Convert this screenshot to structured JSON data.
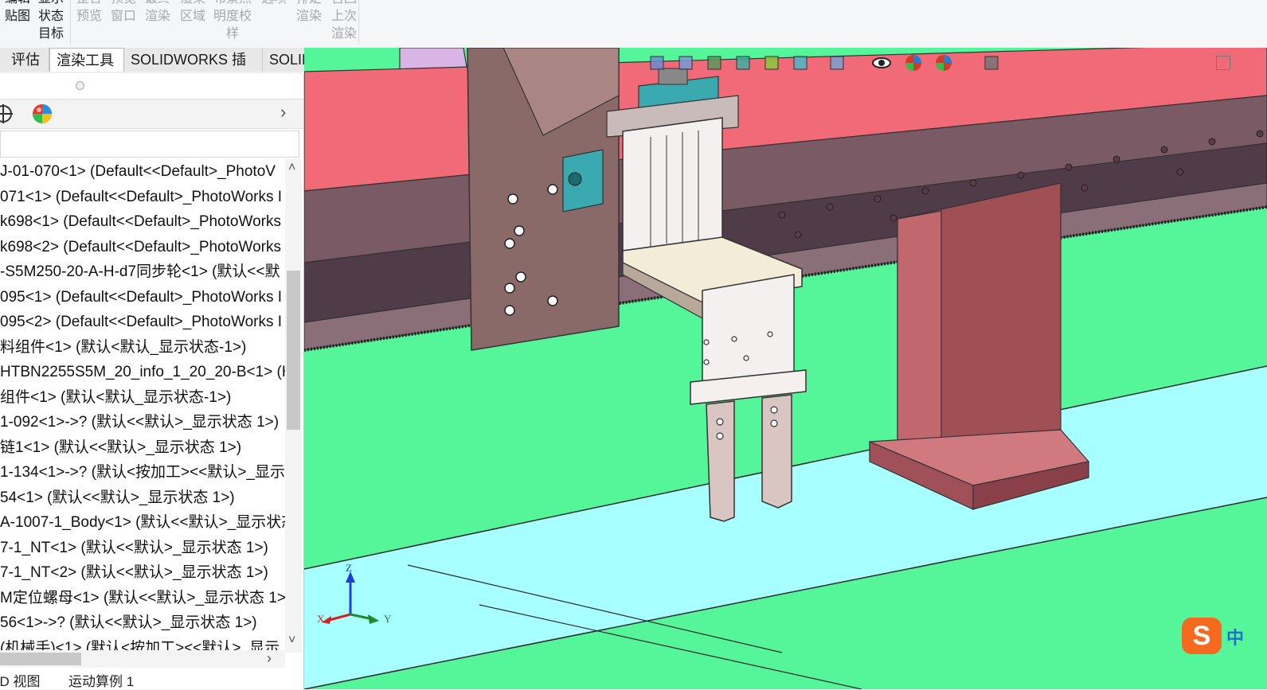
{
  "ribbon": {
    "groups": [
      {
        "lines": [
          "编辑",
          "贴图"
        ],
        "active": true
      },
      {
        "lines": [
          "显示",
          "状态",
          "目标"
        ],
        "active": true
      },
      {
        "lines": [
          "整合",
          "预览"
        ],
        "active": false
      },
      {
        "lines": [
          "预览",
          "窗口"
        ],
        "active": false
      },
      {
        "lines": [
          "最终",
          "渲染"
        ],
        "active": false
      },
      {
        "lines": [
          "渲染",
          "区域"
        ],
        "active": false
      },
      {
        "lines": [
          "布景照",
          "明度校",
          "样"
        ],
        "active": false
      },
      {
        "lines": [
          "选项"
        ],
        "active": false
      },
      {
        "lines": [
          "排定",
          "渲染"
        ],
        "active": false
      },
      {
        "lines": [
          "召回",
          "上次",
          "渲染"
        ],
        "active": false
      }
    ]
  },
  "tabs": [
    "评估",
    "渲染工具",
    "SOLIDWORKS 插件",
    "SOLIDWORKS MBD"
  ],
  "selected_tab": "渲染工具",
  "tree": {
    "items": [
      "J-01-070<1> (Default<<Default>_PhotoV",
      "071<1> (Default<<Default>_PhotoWorks I",
      "k698<1> (Default<<Default>_PhotoWorks",
      "k698<2> (Default<<Default>_PhotoWorks",
      "-S5M250-20-A-H-d7同步轮<1> (默认<<默",
      "095<1> (Default<<Default>_PhotoWorks I",
      "095<2> (Default<<Default>_PhotoWorks I",
      "料组件<1> (默认<默认_显示状态-1>)",
      "HTBN2255S5M_20_info_1_20_20-B<1> (H",
      "组件<1> (默认<默认_显示状态-1>)",
      "1-092<1>->? (默认<<默认>_显示状态 1>)",
      "链1<1> (默认<<默认>_显示状态 1>)",
      "1-134<1>->? (默认<按加工><<默认>_显示",
      " 54<1> (默认<<默认>_显示状态 1>)",
      "A-1007-1_Body<1> (默认<<默认>_显示状态",
      "7-1_NT<1> (默认<<默认>_显示状态 1>)",
      "7-1_NT<2> (默认<<默认>_显示状态 1>)",
      "M定位螺母<1> (默认<<默认>_显示状态 1>)",
      " 56<1>->? (默认<<默认>_显示状态 1>)",
      "(机械手)<1> (默认<按加工><<默认>_显示"
    ]
  },
  "bottom_tabs": [
    "3D 视图",
    "运动算例 1"
  ],
  "triad": {
    "z": "Z",
    "x": "X",
    "y": "Y"
  },
  "ime": {
    "logo": "S",
    "mode": "中"
  },
  "icons": {
    "panel_tools": [
      "crosshair-icon",
      "appearance-ball-icon"
    ],
    "view_tools": [
      "zoom-to-fit-icon",
      "zoom-area-icon",
      "previous-view-icon",
      "section-view-icon",
      "dynamic-annotation-icon",
      "view-orientation-icon",
      "display-style-icon",
      "hide-show-icon",
      "edit-appearance-icon",
      "apply-scene-icon",
      "view-settings-icon"
    ]
  },
  "colors": {
    "floor_green": "#55f59a",
    "floor_cyan": "#a8ffff",
    "beam_red": "#f06a78",
    "column_red": "#a04f55",
    "plate_taupe": "#8a6a68",
    "slide_white": "#f4f0f0",
    "block_teal": "#3aa9b0"
  }
}
